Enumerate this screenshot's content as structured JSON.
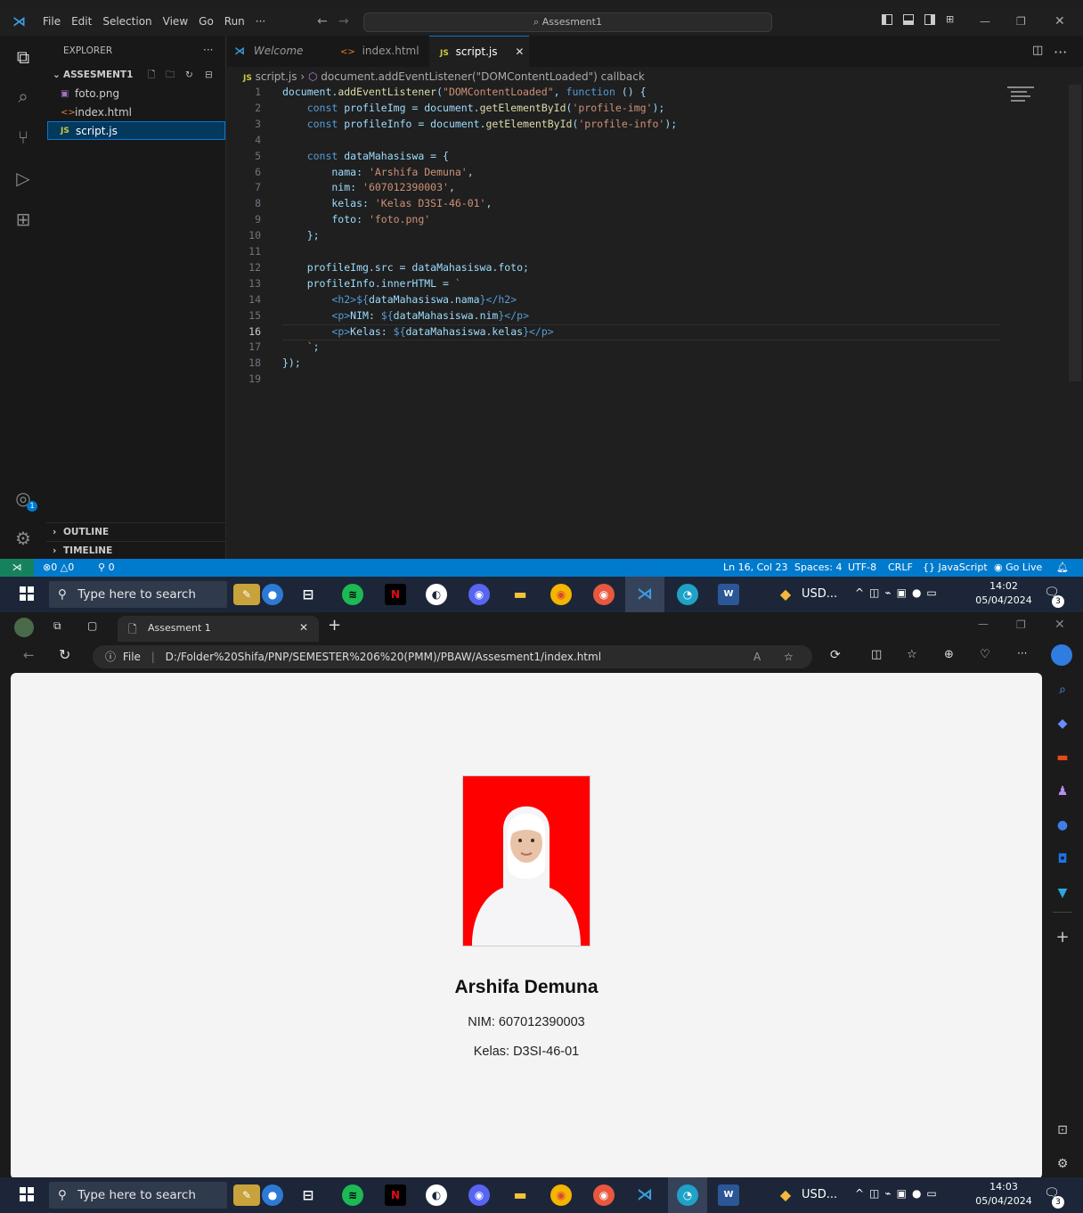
{
  "vscode": {
    "menu": [
      "File",
      "Edit",
      "Selection",
      "View",
      "Go",
      "Run",
      "···"
    ],
    "command_center": "Assesment1",
    "explorer": {
      "title": "EXPLORER",
      "folder": "ASSESMENT1",
      "files": [
        {
          "name": "foto.png",
          "icon": "image-file-icon"
        },
        {
          "name": "index.html",
          "icon": "html-file-icon"
        },
        {
          "name": "script.js",
          "icon": "js-file-icon",
          "selected": true
        }
      ],
      "outline": "OUTLINE",
      "timeline": "TIMELINE"
    },
    "tabs": [
      {
        "label": "Welcome",
        "active": false
      },
      {
        "label": "index.html",
        "active": false
      },
      {
        "label": "script.js",
        "active": true
      }
    ],
    "breadcrumb": {
      "file": "script.js",
      "symbol": "document.addEventListener(\"DOMContentLoaded\") callback"
    },
    "line_numbers": [
      "1",
      "2",
      "3",
      "4",
      "5",
      "6",
      "7",
      "8",
      "9",
      "10",
      "11",
      "12",
      "13",
      "14",
      "15",
      "16",
      "17",
      "18",
      "19"
    ],
    "code": [
      "document.addEventListener(\"DOMContentLoaded\", function () {",
      "    const profileImg = document.getElementById('profile-img');",
      "    const profileInfo = document.getElementById('profile-info');",
      "",
      "    const dataMahasiswa = {",
      "        nama: 'Arshifa Demuna',",
      "        nim: '607012390003',",
      "        kelas: 'Kelas D3SI-46-01',",
      "        foto: 'foto.png'",
      "    };",
      "",
      "    profileImg.src = dataMahasiswa.foto;",
      "    profileInfo.innerHTML = `",
      "        <h2>${dataMahasiswa.nama}</h2>",
      "        <p>NIM: ${dataMahasiswa.nim}</p>",
      "        <p>Kelas: ${dataMahasiswa.kelas}</p>",
      "    `;",
      "});",
      ""
    ],
    "status": {
      "errors": "0",
      "warnings": "0",
      "ports": "0",
      "position": "Ln 16, Col 23",
      "spaces": "Spaces: 4",
      "encoding": "UTF-8",
      "eol": "CRLF",
      "language": "JavaScript",
      "golive": "Go Live"
    }
  },
  "taskbar1": {
    "search": "Type here to search",
    "usd": "USD...",
    "time": "14:02",
    "date": "05/04/2024",
    "notif": "3"
  },
  "taskbar2": {
    "search": "Type here to search",
    "usd": "USD...",
    "time": "14:03",
    "date": "05/04/2024",
    "notif": "3"
  },
  "edge": {
    "tab_title": "Assesment 1",
    "url_prefix": "File",
    "url": "D:/Folder%20Shifa/PNP/SEMESTER%206%20(PMM)/PBAW/Assesment1/index.html"
  },
  "profile": {
    "name": "Arshifa Demuna",
    "nim": "NIM: 607012390003",
    "kelas": "Kelas: D3SI-46-01"
  },
  "colors": {
    "vscode_accent": "#007acc",
    "photo_bg": "#ff0000",
    "taskbar": "#1c2638"
  }
}
